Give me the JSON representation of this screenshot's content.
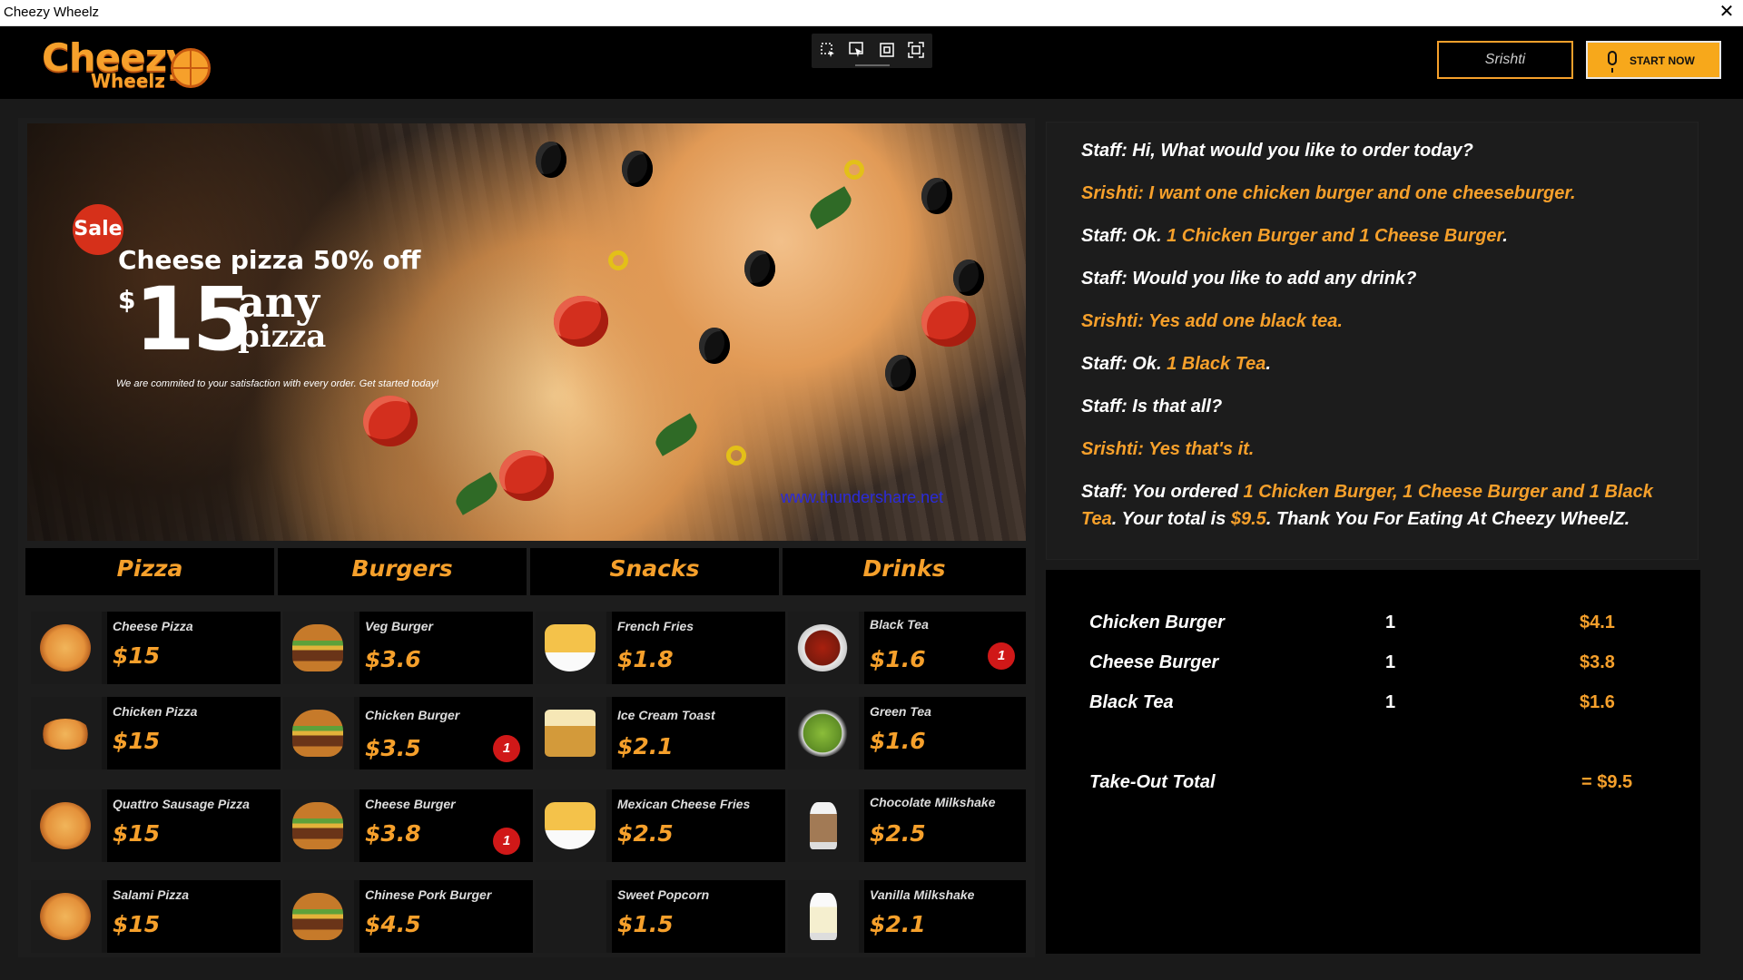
{
  "window": {
    "title": "Cheezy Wheelz",
    "close_glyph": "✕"
  },
  "logo": {
    "line1": "Cheezy",
    "line2": "Wheelz"
  },
  "toolbar": {
    "icons": [
      "select-tool-icon",
      "pointer-icon",
      "frame-icon",
      "fullscreen-icon"
    ]
  },
  "header": {
    "user_name": "Srishti",
    "start_label": "START NOW"
  },
  "banner": {
    "sale": "Sale",
    "headline": "Cheese pizza 50% off",
    "dollar": "$",
    "price": "15",
    "any": "any",
    "pizza": "pizza",
    "tagline": "We are commited to your satisfaction with every order. Get started today!",
    "watermark": "www.thundershare.net"
  },
  "categories": [
    "Pizza",
    "Burgers",
    "Snacks",
    "Drinks"
  ],
  "menu": {
    "pizza": [
      {
        "name": "Cheese Pizza",
        "price": "$15"
      },
      {
        "name": "Chicken Pizza",
        "price": "$15"
      },
      {
        "name": "Quattro Sausage Pizza",
        "price": "$15"
      },
      {
        "name": "Salami Pizza",
        "price": "$15"
      }
    ],
    "burgers": [
      {
        "name": "Veg Burger",
        "price": "$3.6"
      },
      {
        "name": "Chicken Burger",
        "price": "$3.5",
        "qty": "1"
      },
      {
        "name": "Cheese Burger",
        "price": "$3.8",
        "qty": "1"
      },
      {
        "name": "Chinese Pork Burger",
        "price": "$4.5"
      }
    ],
    "snacks": [
      {
        "name": "French Fries",
        "price": "$1.8"
      },
      {
        "name": "Ice Cream Toast",
        "price": "$2.1"
      },
      {
        "name": "Mexican Cheese Fries",
        "price": "$2.5"
      },
      {
        "name": "Sweet Popcorn",
        "price": "$1.5"
      }
    ],
    "drinks": [
      {
        "name": "Black Tea",
        "price": "$1.6",
        "qty": "1"
      },
      {
        "name": "Green Tea",
        "price": "$1.6"
      },
      {
        "name": "Chocolate Milkshake",
        "price": "$2.5"
      },
      {
        "name": "Vanilla Milkshake",
        "price": "$2.1"
      }
    ]
  },
  "chat": {
    "l1": "Staff: Hi, What would you like to order today?",
    "l2": "Srishti: I want one chicken burger and one cheeseburger.",
    "l3a": "Staff: Ok. ",
    "l3b": "1 Chicken Burger and 1 Cheese Burger",
    "l3c": ".",
    "l4": "Staff: Would you like to add any drink?",
    "l5": "Srishti: Yes add one black tea.",
    "l6a": "Staff: Ok. ",
    "l6b": "1 Black Tea",
    "l6c": ".",
    "l7": "Staff: Is that all?",
    "l8": "Srishti: Yes that's it.",
    "l9a": "Staff: You ordered ",
    "l9b": "1 Chicken Burger, 1 Cheese Burger and 1 Black Tea",
    "l9c": ". Your total is ",
    "l9d": "$9.5",
    "l9e": ". Thank You For Eating At Cheezy WheelZ."
  },
  "order": {
    "items": [
      {
        "name": "Chicken Burger",
        "qty": "1",
        "price": "$4.1"
      },
      {
        "name": "Cheese Burger",
        "qty": "1",
        "price": "$3.8"
      },
      {
        "name": "Black Tea",
        "qty": "1",
        "price": "$1.6"
      }
    ],
    "total_label": "Take-Out Total",
    "total_value": "= $9.5"
  },
  "colors": {
    "accent": "#f6a02b",
    "badge": "#d01818",
    "background": "#1a1a1a"
  }
}
